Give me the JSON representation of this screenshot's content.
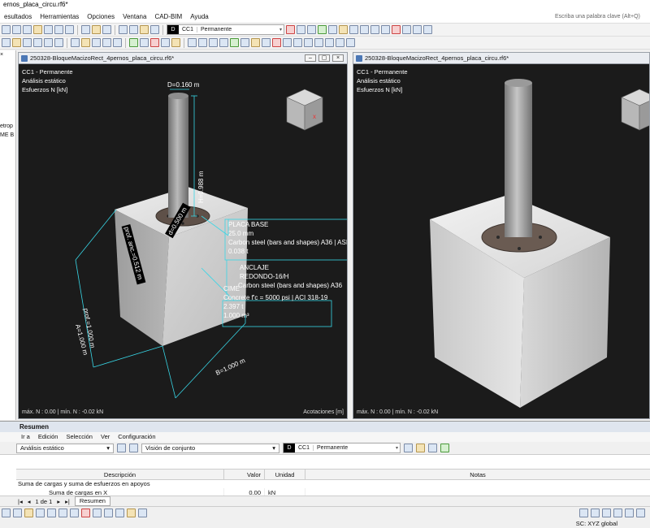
{
  "app": {
    "title": "ernos_placa_circu.rf6*"
  },
  "menu": {
    "items": [
      "esultados",
      "Herramientas",
      "Opciones",
      "Ventana",
      "CAD-BIM",
      "Ayuda"
    ],
    "search_placeholder": "Escriba una palabra clave (Alt+Q)"
  },
  "toolbar": {
    "loadcase_type": "D",
    "loadcase_code": "CC1",
    "loadcase_name": "Permanente"
  },
  "left_panel": {
    "lines": [
      "etrop",
      "ME B"
    ]
  },
  "window_left": {
    "title": "250328-BloqueMacizoRect_4pernos_placa_circu.rf6*",
    "info": [
      "CC1 - Permanente",
      "Análisis estático",
      "Esfuerzos N [kN]"
    ],
    "footer_left": "máx. N : 0.00 | mín. N : -0.02 kN",
    "footer_right": "Acotaciones [m]",
    "dims": {
      "diameter": "D=0.160 m",
      "height": "H=0.988 m",
      "plate_diameter": "d=0.500 m",
      "anchor_depth": "prof. anc.=0.512 m",
      "depth": "prof.=1.000 m",
      "width_a": "A=1.000 m",
      "width_b": "B=1.000 m"
    },
    "labels": {
      "plate_title": "PLACA BASE",
      "plate_thk": "25.0 mm",
      "plate_mat": "Carbon steel (bars and shapes) A36 | ASI",
      "plate_val": "0.038 t",
      "anchor_title": "ANCLAJE",
      "anchor_type": "REDONDO-16/H",
      "anchor_mat": "Carbon steel (bars and shapes) A36",
      "found_title": "CIME",
      "found_mat": "Concrete f'c = 5000 psi | ACI 318-19",
      "found_weight": "2.397 t",
      "found_vol": "1.000 m³"
    }
  },
  "window_right": {
    "title": "250328-BloqueMacizoRect_4pernos_placa_circu.rf6*",
    "info": [
      "CC1 - Permanente",
      "Análisis estático",
      "Esfuerzos N [kN]"
    ],
    "footer_left": "máx. N : 0.00 | mín. N : -0.02 kN"
  },
  "summary": {
    "title": "Resumen",
    "menu": [
      "Ir a",
      "Edición",
      "Selección",
      "Ver",
      "Configuración"
    ],
    "analysis_select": "Análisis estático",
    "view_select": "Visión de conjunto",
    "loadcase_type": "D",
    "loadcase_code": "CC1",
    "loadcase_name": "Permanente",
    "columns": [
      "Descripción",
      "Valor",
      "Unidad",
      "Notas"
    ],
    "group": "Suma de cargas y suma de esfuerzos en apoyos",
    "rows": [
      {
        "desc": "Suma de cargas en X",
        "value": "0.00",
        "unit": "kN",
        "notes": ""
      }
    ],
    "pager": "1 de 1",
    "tab": "Resumen"
  },
  "status": {
    "coord_system": "SC: XYZ global"
  }
}
